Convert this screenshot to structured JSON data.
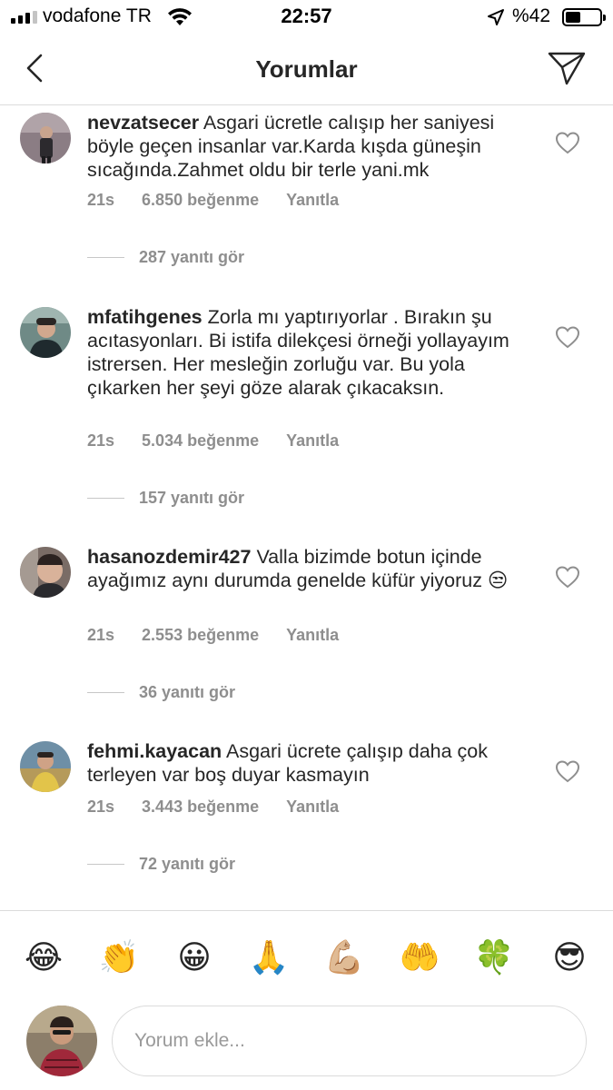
{
  "status_bar": {
    "carrier": "vodafone TR",
    "time": "22:57",
    "battery_percent": "%42",
    "battery_level": 0.42,
    "signal_bars_active": 3,
    "signal_bars_total": 4
  },
  "header": {
    "title": "Yorumlar",
    "back_icon": "chevron-left-icon",
    "send_icon": "paper-plane-icon"
  },
  "comments": [
    {
      "username": "nevzatsecer",
      "text": "Asgari ücretle calışıp her saniyesi böyle geçen insanlar var.Karda kışda güneşin sıcağında.Zahmet oldu bir terle yani.mk",
      "time": "21s",
      "likes": "6.850 beğenme",
      "reply_label": "Yanıtla",
      "view_replies": "287 yanıtı gör",
      "avatar_color": "#5a4a4f"
    },
    {
      "username": "mfatihgenes",
      "text": "Zorla mı yaptırıyorlar . Bırakın şu acıtasyonları. Bi istifa dilekçesi örneği yollayayım istrersen. Her mesleğin zorluğu var. Bu yola çıkarken her şeyi göze alarak çıkacaksın.",
      "time": "21s",
      "likes": "5.034 beğenme",
      "reply_label": "Yanıtla",
      "view_replies": "157 yanıtı gör",
      "avatar_color": "#4a5a55"
    },
    {
      "username": "hasanozdemir427",
      "text": "Valla bizimde botun içinde ayağımız aynı durumda genelde küfür yiyoruz",
      "emoji": "😒",
      "time": "21s",
      "likes": "2.553 beğenme",
      "reply_label": "Yanıtla",
      "view_replies": "36 yanıtı gör",
      "avatar_color": "#3e3a3a"
    },
    {
      "username": "fehmi.kayacan",
      "text": "Asgari ücrete çalışıp daha çok terleyen var boş duyar kasmayın",
      "time": "21s",
      "likes": "3.443 beğenme",
      "reply_label": "Yanıtla",
      "view_replies": "72 yanıtı gör",
      "avatar_color": "#8a7a3a"
    }
  ],
  "emoji_bar": {
    "items": [
      "😂",
      "👏",
      "😀",
      "🙏",
      "💪🏼",
      "🤲",
      "🍀",
      "😎"
    ]
  },
  "composer": {
    "placeholder": "Yorum ekle...",
    "value": ""
  },
  "colors": {
    "text": "#262626",
    "secondary": "#8e8e8e",
    "divider": "#dbdbdb"
  }
}
